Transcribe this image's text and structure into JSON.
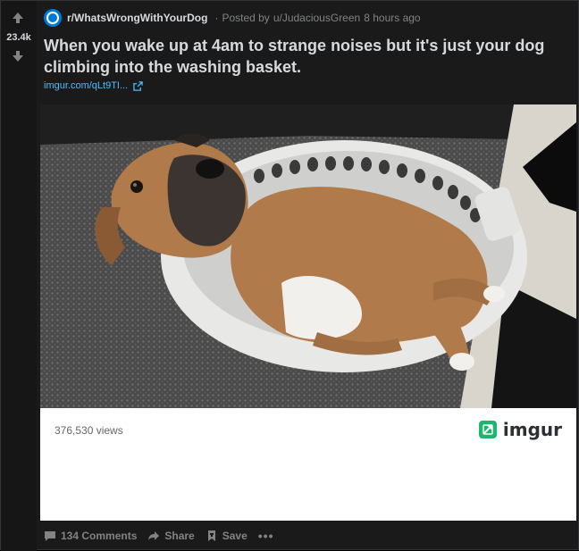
{
  "votes": {
    "score": "23.4k",
    "upvote_icon": "arrow-up-icon",
    "downvote_icon": "arrow-down-icon"
  },
  "header": {
    "subreddit": "r/WhatsWrongWithYourDog",
    "separator": "·",
    "posted_by_prefix": "Posted by",
    "author": "u/JudaciousGreen",
    "time": "8 hours ago"
  },
  "post": {
    "title": "When you wake up at 4am to strange noises but it's just your dog climbing into the washing basket.",
    "link_text": "imgur.com/qLt9TI...",
    "link_icon": "external-link-icon"
  },
  "embed": {
    "views": "376,530 views",
    "brand": "imgur",
    "brand_color": "#1bb76e"
  },
  "footer": {
    "comments": "134 Comments",
    "share": "Share",
    "save": "Save",
    "more": "•••"
  },
  "colors": {
    "background": "#1a1a1b",
    "text": "#d7dadc",
    "muted": "#818384",
    "link": "#4fbcff",
    "subreddit_icon": "#0079d3"
  }
}
